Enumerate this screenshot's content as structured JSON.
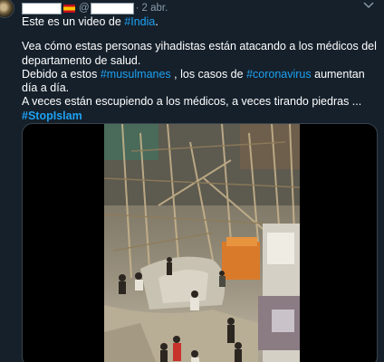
{
  "tweet": {
    "separator": "·",
    "date": "2 abr.",
    "handle_prefix": "@",
    "lines": {
      "l1_a": "Este es un video de ",
      "l1_tag": "#India",
      "l1_b": ".",
      "l2_a": " Vea cómo estas personas yihadistas están atacando a los médicos del departamento de salud.",
      "l3_a": " Debido a estos ",
      "l3_tag": "#musulmanes",
      "l3_b": " , los casos de ",
      "l3_tag2": "#coronavirus",
      "l3_c": " aumentan día a día.",
      "l4_a": " A veces están escupiendo a los médicos, a veces tirando piedras ...",
      "l5_tag": " #StopIslam"
    }
  },
  "colors": {
    "background": "#15202b",
    "link": "#1da1f2",
    "muted": "#8899a6"
  }
}
